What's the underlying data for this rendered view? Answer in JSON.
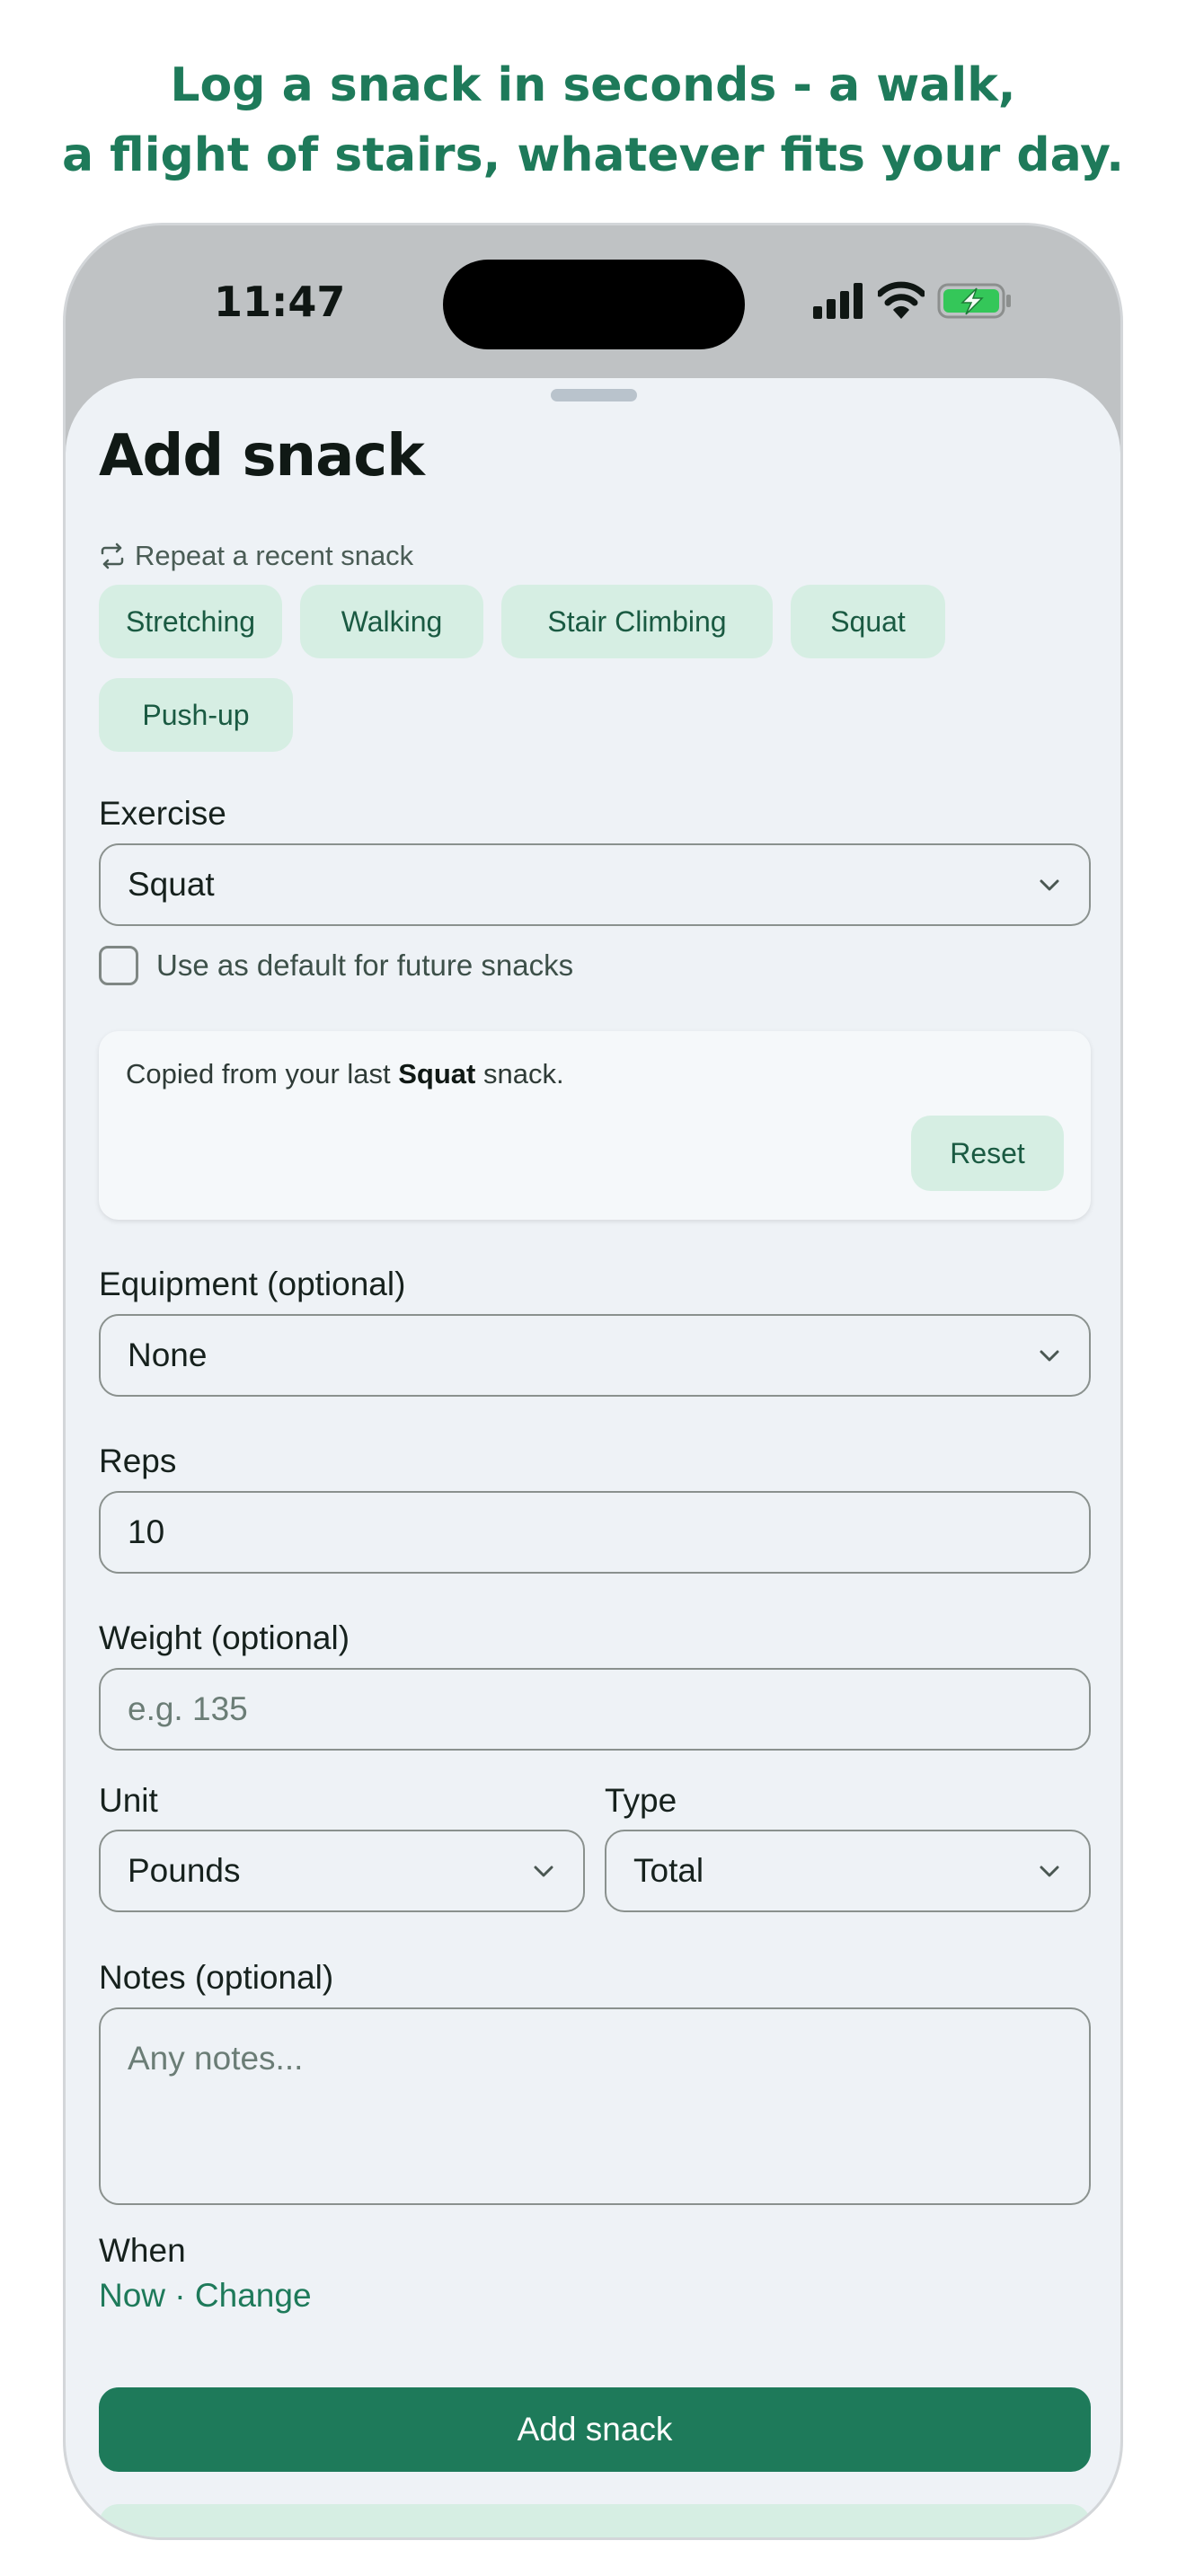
{
  "headline": {
    "line1": "Log a snack in seconds - a walk,",
    "line2": "a flight of stairs, whatever fits your day."
  },
  "status_bar": {
    "time": "11:47",
    "icons": [
      "cellular-signal-icon",
      "wifi-icon",
      "battery-charging-icon"
    ],
    "battery_color": "#34c759"
  },
  "sheet": {
    "title": "Add snack",
    "recent": {
      "label": "Repeat a recent snack",
      "icon": "repeat-icon",
      "chips": [
        "Stretching",
        "Walking",
        "Stair Climbing",
        "Squat",
        "Push-up"
      ]
    },
    "exercise": {
      "label": "Exercise",
      "value": "Squat",
      "default_checkbox_label": "Use as default for future snacks",
      "default_checked": false
    },
    "copied_card": {
      "prefix": "Copied from your last ",
      "exercise": "Squat",
      "suffix": " snack.",
      "reset_label": "Reset"
    },
    "equipment": {
      "label": "Equipment (optional)",
      "value": "None"
    },
    "reps": {
      "label": "Reps",
      "value": "10"
    },
    "weight": {
      "label": "Weight (optional)",
      "placeholder": "e.g. 135",
      "value": ""
    },
    "unit": {
      "label": "Unit",
      "value": "Pounds"
    },
    "type": {
      "label": "Type",
      "value": "Total"
    },
    "notes": {
      "label": "Notes (optional)",
      "placeholder": "Any notes..."
    },
    "when": {
      "label": "When",
      "value": "Now",
      "separator": " · ",
      "change_label": "Change"
    },
    "submit_label": "Add snack"
  },
  "colors": {
    "accent": "#1e7a5a",
    "chip_bg": "#d6eee3",
    "sheet_bg": "#eef2f6",
    "phone_frame": "#bfc2c4"
  }
}
